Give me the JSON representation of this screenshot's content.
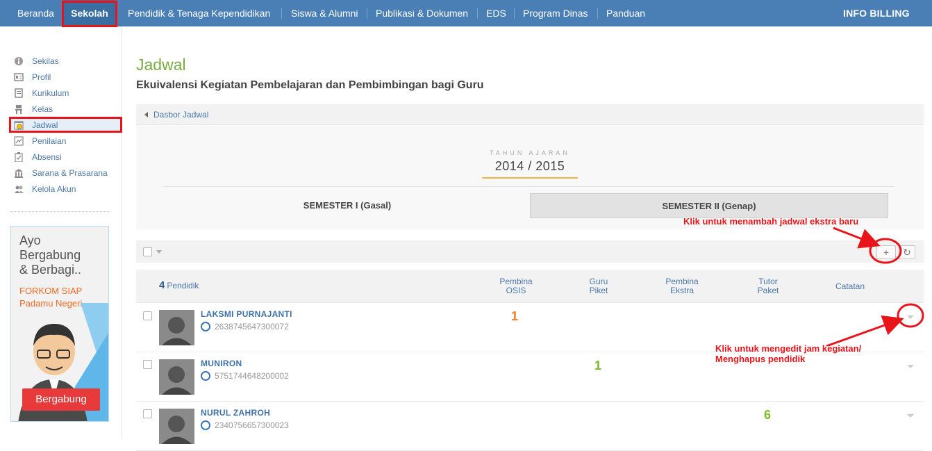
{
  "topnav": {
    "items": [
      "Beranda",
      "Sekolah",
      "Pendidik & Tenaga Kependidikan",
      "Siswa & Alumni",
      "Publikasi & Dokumen",
      "EDS",
      "Program Dinas",
      "Panduan"
    ],
    "billing": "INFO BILLING"
  },
  "sidebar": {
    "items": [
      {
        "label": "Sekilas",
        "icon": "info-icon"
      },
      {
        "label": "Profil",
        "icon": "profile-card-icon"
      },
      {
        "label": "Kurikulum",
        "icon": "book-icon"
      },
      {
        "label": "Kelas",
        "icon": "chair-icon"
      },
      {
        "label": "Jadwal",
        "icon": "clock-calendar-icon"
      },
      {
        "label": "Penilaian",
        "icon": "chart-icon"
      },
      {
        "label": "Absensi",
        "icon": "clipboard-check-icon"
      },
      {
        "label": "Sarana & Prasarana",
        "icon": "building-icon"
      },
      {
        "label": "Kelola Akun",
        "icon": "users-icon"
      }
    ]
  },
  "banner": {
    "title_1": "Ayo",
    "title_2": "Bergabung",
    "title_3": "& Berbagi..",
    "sub_1": "FORKOM SIAP",
    "sub_2": "Padamu Negeri",
    "button": "Bergabung"
  },
  "page": {
    "title": "Jadwal",
    "subtitle": "Ekuivalensi Kegiatan Pembelajaran dan Pembimbingan bagi Guru",
    "breadcrumb": "Dasbor Jadwal"
  },
  "year": {
    "label": "TAHUN AJARAN",
    "value": "2014 / 2015"
  },
  "semesters": [
    "SEMESTER I (Gasal)",
    "SEMESTER II (Genap)"
  ],
  "table": {
    "count": "4",
    "count_label": "Pendidik",
    "columns": [
      {
        "l1": "Pembina",
        "l2": "OSIS"
      },
      {
        "l1": "Guru",
        "l2": "Piket"
      },
      {
        "l1": "Pembina",
        "l2": "Ekstra"
      },
      {
        "l1": "Tutor",
        "l2": "Paket"
      },
      {
        "l1": "Catatan",
        "l2": ""
      }
    ],
    "rows": [
      {
        "name": "LAKSMI PURNAJANTI",
        "nuptk": "2638745647300072",
        "value": "1",
        "col": 0,
        "color": "#f07d2a"
      },
      {
        "name": "MUNIRON",
        "nuptk": "5751744648200002",
        "value": "1",
        "col": 1,
        "color": "#7dbb2e"
      },
      {
        "name": "NURUL ZAHROH",
        "nuptk": "2340756657300023",
        "value": "6",
        "col": 3,
        "color": "#7dbb2e"
      }
    ]
  },
  "annotations": {
    "add": "Klik untuk menambah jadwal ekstra baru",
    "edit_1": "Klik untuk mengedit jam kegiatan/",
    "edit_2": "Menghapus pendidik"
  },
  "colors": {
    "nav": "#4a7fb5",
    "title": "#7bab43",
    "link": "#4a77a8",
    "annotation": "#e8141a"
  }
}
